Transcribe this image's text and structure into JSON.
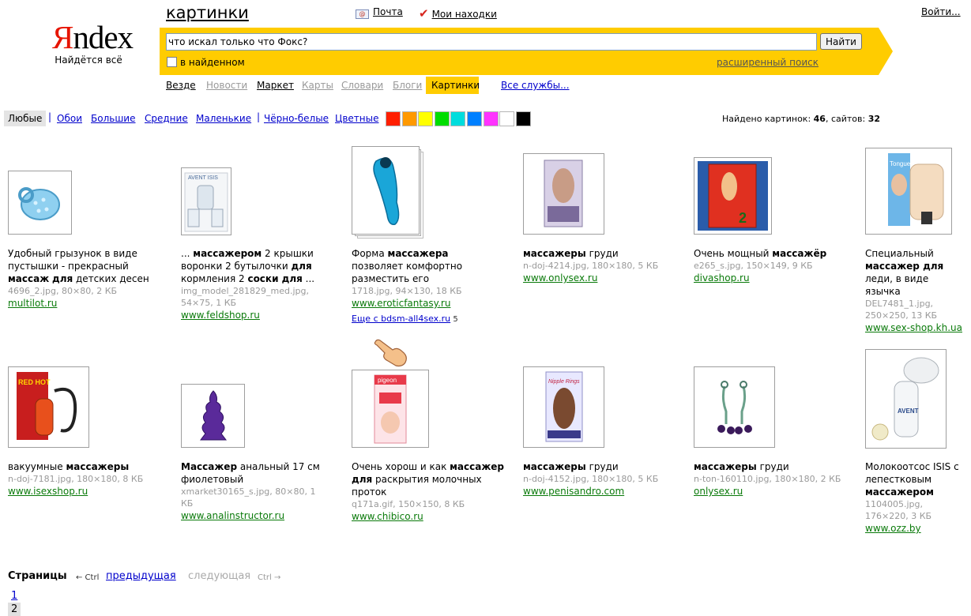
{
  "header": {
    "logo_letter": "Я",
    "logo_rest": "ndex",
    "slogan": "Найдётся всё",
    "service_title": "картинки",
    "mail_label": "Почта",
    "finds_label": "Мои находки",
    "login_label": "Войти..."
  },
  "search": {
    "query": "что искал только что Фокс?",
    "button_label": "Найти",
    "in_found_label": "в найденном",
    "advanced_label": "расширенный поиск"
  },
  "nav": {
    "items": [
      "Везде",
      "Новости",
      "Маркет",
      "Карты",
      "Словари",
      "Блоги",
      "Картинки"
    ],
    "all_services": "Все службы..."
  },
  "filters": {
    "sizes": [
      "Любые",
      "Обои",
      "Большие",
      "Средние",
      "Маленькие",
      "Чёрно-белые",
      "Цветные"
    ],
    "colors": [
      "#ff1f00",
      "#ff9900",
      "#ffff00",
      "#00dd00",
      "#00dddd",
      "#0080ff",
      "#ff33ff",
      "#ffffff",
      "#000000"
    ]
  },
  "stats": {
    "label": "Найдено картинок:",
    "images": "46",
    "sites_label": ", сайтов:",
    "sites": "32"
  },
  "results": [
    {
      "text": [
        [
          "",
          "Удобный грызунок в виде пустышки - прекрасный "
        ],
        [
          "b",
          "массаж"
        ],
        [
          "",
          " "
        ],
        [
          "b",
          "для"
        ],
        [
          "",
          " детских десен"
        ]
      ],
      "meta": "4696_2.jpg, 80×80, 2 КБ",
      "source": "multilot.ru"
    },
    {
      "text": [
        [
          "",
          "... "
        ],
        [
          "b",
          "массажером"
        ],
        [
          "",
          " 2 крышки воронки 2 бутылочки "
        ],
        [
          "b",
          "для"
        ],
        [
          "",
          " кормления 2 "
        ],
        [
          "b",
          "соски для"
        ],
        [
          "",
          " ..."
        ]
      ],
      "meta": "img_model_281829_med.jpg, 54×75, 1 КБ",
      "source": "www.feldshop.ru"
    },
    {
      "text": [
        [
          "",
          "Форма "
        ],
        [
          "b",
          "массажера"
        ],
        [
          "",
          " позволяет комфортно разместить его"
        ]
      ],
      "meta": "1718.jpg, 94×130, 18 КБ",
      "source": "www.eroticfantasy.ru",
      "more": "Еще с bdsm-all4sex.ru",
      "more_count": "5"
    },
    {
      "text": [
        [
          "b",
          "массажеры"
        ],
        [
          "",
          " груди"
        ]
      ],
      "meta": "n-doj-4214.jpg, 180×180, 5 КБ",
      "source": "www.onlysex.ru"
    },
    {
      "text": [
        [
          "",
          "Очень мощный "
        ],
        [
          "b",
          "массажёр"
        ]
      ],
      "meta": "e265_s.jpg, 150×149, 9 КБ",
      "source": "divashop.ru"
    },
    {
      "text": [
        [
          "",
          "Специальный "
        ],
        [
          "b",
          "массажер для"
        ],
        [
          "",
          " леди, в виде язычка"
        ]
      ],
      "meta": "DEL7481_1.jpg, 250×250, 13 КБ",
      "source": "www.sex-shop.kh.ua"
    },
    {
      "text": [
        [
          "",
          "вакуумные "
        ],
        [
          "b",
          "массажеры"
        ]
      ],
      "meta": "n-doj-7181.jpg, 180×180, 8 КБ",
      "source": "www.isexshop.ru"
    },
    {
      "text": [
        [
          "b",
          "Массажер"
        ],
        [
          "",
          " анальный 17 см фиолетовый"
        ]
      ],
      "meta": "xmarket30165_s.jpg, 80×80, 1 КБ",
      "source": "www.analinstructor.ru"
    },
    {
      "text": [
        [
          "",
          "Очень хорош и как "
        ],
        [
          "b",
          "массажер для"
        ],
        [
          "",
          " раскрытия молочных проток"
        ]
      ],
      "meta": "q171a.gif, 150×150, 8 КБ",
      "source": "www.chibico.ru"
    },
    {
      "text": [
        [
          "b",
          "массажеры"
        ],
        [
          "",
          " груди"
        ]
      ],
      "meta": "n-doj-4152.jpg, 180×180, 5 КБ",
      "source": "www.penisandro.com"
    },
    {
      "text": [
        [
          "b",
          "массажеры"
        ],
        [
          "",
          " груди"
        ]
      ],
      "meta": "n-ton-160110.jpg, 180×180, 2 КБ",
      "source": "onlysex.ru"
    },
    {
      "text": [
        [
          "",
          "Молокоотсос ISIS с лепестковым "
        ],
        [
          "b",
          "массажером"
        ]
      ],
      "meta": "1104005.jpg, 176×220, 3 КБ",
      "source": "www.ozz.by"
    }
  ],
  "thumb_art": {
    "r0": "AVENT ISIS",
    "r3": "Nipple Rings",
    "r5": "Tongue",
    "r6": "RED HOT",
    "r8": "pigeon",
    "r11": "AVENT"
  },
  "pager": {
    "title": "Страницы",
    "prev_hint": "← Ctrl",
    "prev": "предыдущая",
    "next": "следующая",
    "next_hint": "Ctrl →",
    "pages": [
      "1",
      "2"
    ],
    "current": "2"
  }
}
